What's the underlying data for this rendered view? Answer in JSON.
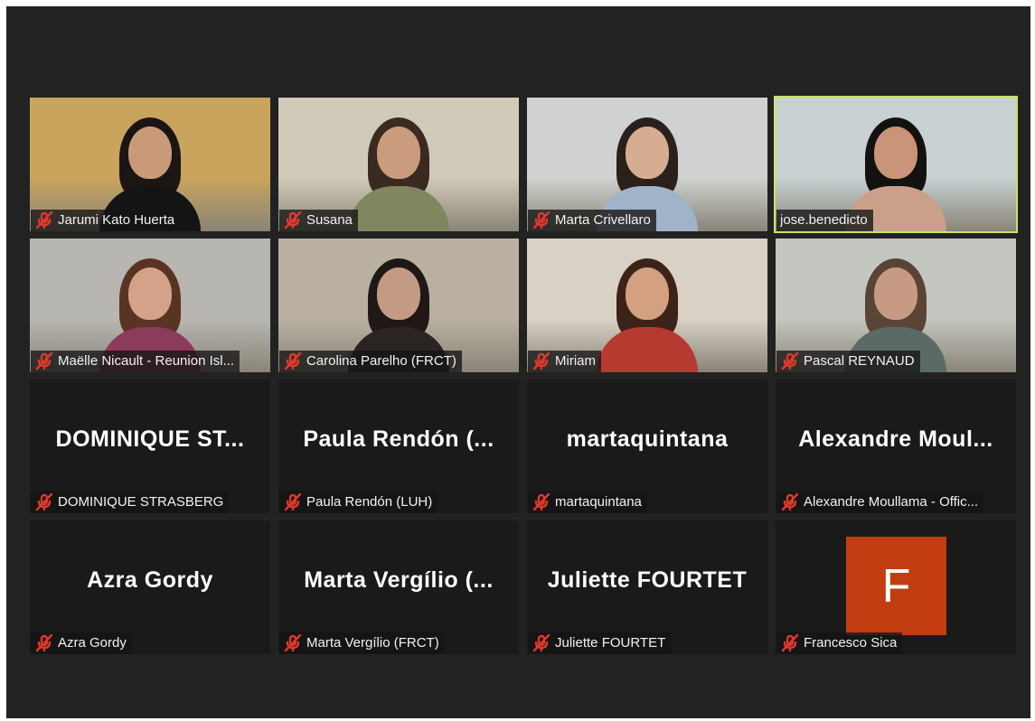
{
  "meeting": {
    "participants": [
      {
        "label": "Jarumi Kato Huerta",
        "center": "",
        "muted": true,
        "video": true,
        "active": false,
        "bg": "#c9a45c",
        "skin": "#c99a7a",
        "hair": "#1b1514",
        "shirt": "#141414"
      },
      {
        "label": "Susana",
        "center": "",
        "muted": true,
        "video": true,
        "active": false,
        "bg": "#d2cab8",
        "skin": "#c89c7c",
        "hair": "#3a2a20",
        "shirt": "#7f8660"
      },
      {
        "label": "Marta Crivellaro",
        "center": "",
        "muted": true,
        "video": true,
        "active": false,
        "bg": "#cfd2d0",
        "skin": "#d7ad92",
        "hair": "#2a201c",
        "shirt": "#9fb3c9"
      },
      {
        "label": "jose.benedicto",
        "center": "",
        "muted": false,
        "video": true,
        "active": true,
        "bg": "#c7d1d2",
        "skin": "#c99479",
        "hair": "#141211",
        "shirt": "#caa08a"
      },
      {
        "label": "Maëlle Nicault - Reunion Isl...",
        "center": "",
        "muted": true,
        "video": true,
        "active": false,
        "bg": "#b7b6b1",
        "skin": "#d3a288",
        "hair": "#5a3423",
        "shirt": "#8b3b5b"
      },
      {
        "label": "Carolina Parelho (FRCT)",
        "center": "",
        "muted": true,
        "video": true,
        "active": false,
        "bg": "#b9b0a2",
        "skin": "#c39a84",
        "hair": "#1f1817",
        "shirt": "#2a2523"
      },
      {
        "label": "Miriam",
        "center": "",
        "muted": true,
        "video": true,
        "active": false,
        "bg": "#d9d1c6",
        "skin": "#d3a080",
        "hair": "#3b2318",
        "shirt": "#b63a30"
      },
      {
        "label": "Pascal REYNAUD",
        "center": "",
        "muted": true,
        "video": true,
        "active": false,
        "bg": "#c4c7bf",
        "skin": "#c79b83",
        "hair": "#5a4436",
        "shirt": "#5a6b66"
      },
      {
        "label": "DOMINIQUE STRASBERG",
        "center": "DOMINIQUE ST...",
        "muted": true,
        "video": false,
        "active": false
      },
      {
        "label": "Paula Rendón (LUH)",
        "center": "Paula Rendón (...",
        "muted": true,
        "video": false,
        "active": false
      },
      {
        "label": "martaquintana",
        "center": "martaquintana",
        "muted": true,
        "video": false,
        "active": false
      },
      {
        "label": "Alexandre Moullama - Offic...",
        "center": "Alexandre Moul...",
        "muted": true,
        "video": false,
        "active": false
      },
      {
        "label": "Azra Gordy",
        "center": "Azra Gordy",
        "muted": true,
        "video": false,
        "active": false
      },
      {
        "label": "Marta Vergílio (FRCT)",
        "center": "Marta Vergílio (...",
        "muted": true,
        "video": false,
        "active": false
      },
      {
        "label": "Juliette FOURTET",
        "center": "Juliette FOURTET",
        "muted": true,
        "video": false,
        "active": false
      },
      {
        "label": "Francesco Sica",
        "center": "",
        "avatar": "F",
        "avatar_color": "#c23e12",
        "muted": true,
        "video": false,
        "active": false
      }
    ],
    "icons": {
      "muted": "mic-muted-icon"
    },
    "colors": {
      "background": "#222222",
      "tile": "#1a1a1a",
      "active_border": "#c9e265",
      "mute_red": "#e0392b"
    }
  }
}
